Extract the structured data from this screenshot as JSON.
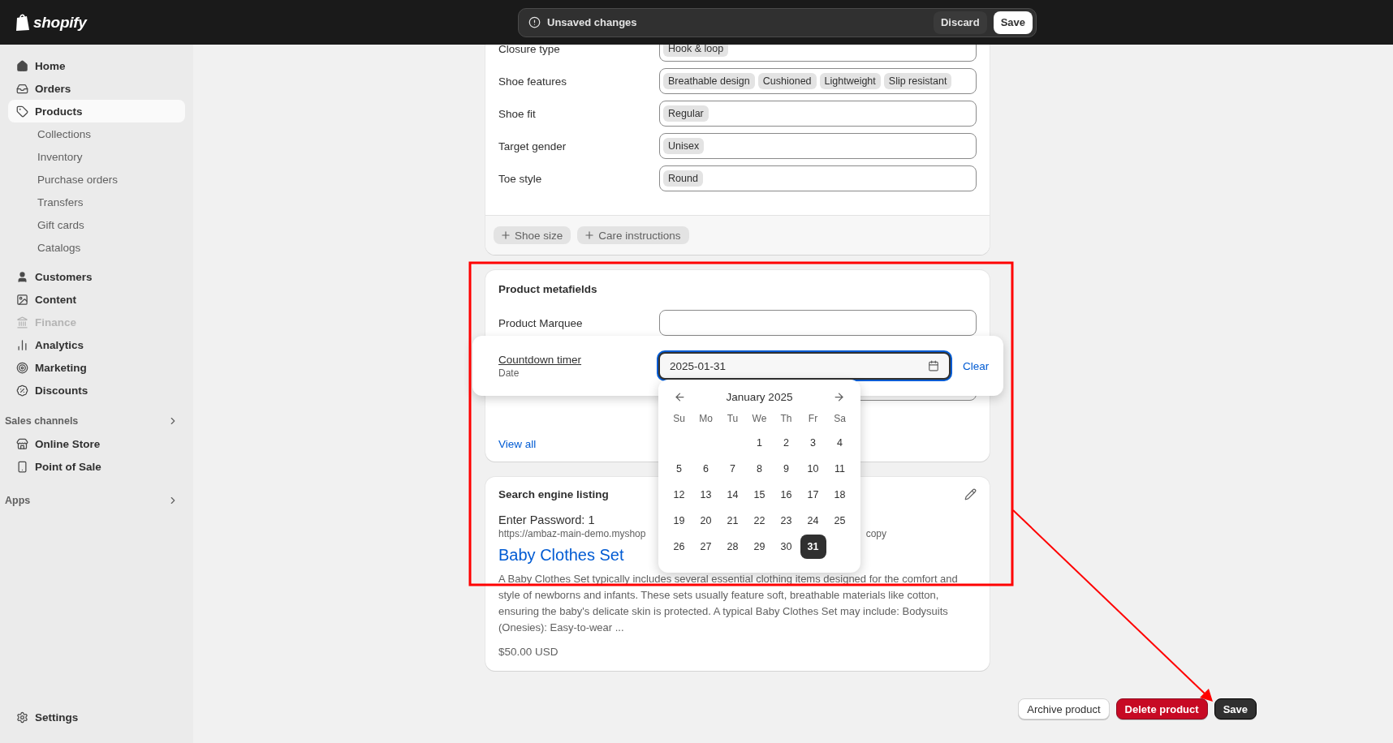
{
  "topbar": {
    "logo": "shopify",
    "notice": "Unsaved changes",
    "buttons": [
      {
        "label": "Discard",
        "kind": "secondary"
      },
      {
        "label": "Save",
        "kind": "primary"
      }
    ]
  },
  "sidebar": {
    "items": [
      {
        "label": "Home",
        "selected": false,
        "disabled": false
      },
      {
        "label": "Orders",
        "selected": false,
        "disabled": false
      },
      {
        "label": "Products",
        "selected": true,
        "disabled": false,
        "children": [
          {
            "label": "Collections",
            "selected": false
          },
          {
            "label": "Inventory",
            "selected": false
          },
          {
            "label": "Purchase orders",
            "selected": false
          },
          {
            "label": "Transfers",
            "selected": false
          },
          {
            "label": "Gift cards",
            "selected": false
          },
          {
            "label": "Catalogs",
            "selected": false
          }
        ]
      },
      {
        "label": "Customers",
        "selected": false,
        "disabled": false
      },
      {
        "label": "Content",
        "selected": false,
        "disabled": false
      },
      {
        "label": "Finance",
        "selected": false,
        "disabled": true
      },
      {
        "label": "Analytics",
        "selected": false,
        "disabled": false
      },
      {
        "label": "Marketing",
        "selected": false,
        "disabled": false
      },
      {
        "label": "Discounts",
        "selected": false,
        "disabled": false
      }
    ],
    "sections": [
      {
        "title": "Sales channels",
        "items": [
          {
            "label": "Online Store",
            "selected": false
          },
          {
            "label": "Point of Sale",
            "selected": false
          }
        ]
      },
      {
        "title": "Apps"
      }
    ],
    "settings": "Settings"
  },
  "attributes_card": {
    "rows": [
      {
        "label": "Closure type",
        "tags": [
          "Hook & loop"
        ]
      },
      {
        "label": "Shoe features",
        "tags": [
          "Breathable design",
          "Cushioned",
          "Lightweight",
          "Slip resistant"
        ]
      },
      {
        "label": "Shoe fit",
        "tags": [
          "Regular"
        ]
      },
      {
        "label": "Target gender",
        "tags": [
          "Unisex"
        ]
      },
      {
        "label": "Toe style",
        "tags": [
          "Round"
        ]
      }
    ],
    "add_buttons": [
      "Shoe size",
      "Care instructions"
    ]
  },
  "metafields_card": {
    "title": "Product metafields",
    "rows": [
      {
        "label": "Product Marquee"
      }
    ],
    "active_field": {
      "label": "Countdown timer",
      "type_label": "Date",
      "value": "2025-01-31",
      "focused": true,
      "clear": "Clear"
    },
    "view_all": "View all"
  },
  "date_picker": {
    "month": "January 2025",
    "weekdays": [
      "Su",
      "Mo",
      "Tu",
      "We",
      "Th",
      "Fr",
      "Sa"
    ],
    "weeks": [
      [
        {
          "day": "1",
          "selected": false
        },
        {
          "day": "2",
          "selected": false
        },
        {
          "day": "3",
          "selected": false
        },
        {
          "day": "4",
          "selected": false
        }
      ],
      [
        {
          "day": "5",
          "selected": false
        },
        {
          "day": "6",
          "selected": false
        },
        {
          "day": "7",
          "selected": false
        },
        {
          "day": "8",
          "selected": false
        },
        {
          "day": "9",
          "selected": false
        },
        {
          "day": "10",
          "selected": false
        },
        {
          "day": "11",
          "selected": false
        }
      ],
      [
        {
          "day": "12",
          "selected": false
        },
        {
          "day": "13",
          "selected": false
        },
        {
          "day": "14",
          "selected": false
        },
        {
          "day": "15",
          "selected": false
        },
        {
          "day": "16",
          "selected": false
        },
        {
          "day": "17",
          "selected": false
        },
        {
          "day": "18",
          "selected": false
        }
      ],
      [
        {
          "day": "19",
          "selected": false
        },
        {
          "day": "20",
          "selected": false
        },
        {
          "day": "21",
          "selected": false
        },
        {
          "day": "22",
          "selected": false
        },
        {
          "day": "23",
          "selected": false
        },
        {
          "day": "24",
          "selected": false
        },
        {
          "day": "25",
          "selected": false
        }
      ],
      [
        {
          "day": "26",
          "selected": false
        },
        {
          "day": "27",
          "selected": false
        },
        {
          "day": "28",
          "selected": false
        },
        {
          "day": "29",
          "selected": false
        },
        {
          "day": "30",
          "selected": false
        },
        {
          "day": "31",
          "selected": true
        }
      ]
    ]
  },
  "seo_card": {
    "title": "Search engine listing",
    "page_title": "Enter Password: 1",
    "url_start": "https://ambaz-main-demo.myshop",
    "url_end": "copy",
    "product_title": "Baby Clothes Set",
    "description": "A Baby Clothes Set typically includes several essential clothing items designed for the comfort and style of newborns and infants. These sets usually feature soft, breathable materials like cotton, ensuring the baby's delicate skin is protected. A typical Baby Clothes Set may include: Bodysuits (Onesies): Easy-to-wear ...",
    "price": "$50.00 USD"
  },
  "actions": [
    {
      "label": "Archive product",
      "kind": "secondary"
    },
    {
      "label": "Delete product",
      "kind": "critical"
    },
    {
      "label": "Save",
      "kind": "primary"
    }
  ]
}
